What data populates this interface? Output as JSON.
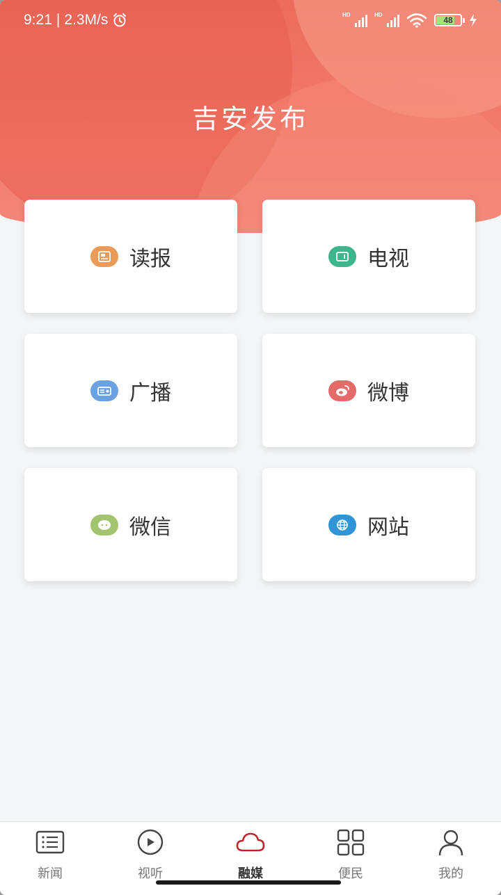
{
  "status_bar": {
    "time": "9:21",
    "separator": "|",
    "speed": "2.3M/s",
    "sim1_label": "HD",
    "sim2_label": "HD",
    "battery": "48"
  },
  "header": {
    "title": "吉安发布"
  },
  "cards": [
    {
      "label": "读报",
      "icon": "newspaper-icon",
      "color": "#ec9a57"
    },
    {
      "label": "电视",
      "icon": "tv-icon",
      "color": "#3fb58e"
    },
    {
      "label": "广播",
      "icon": "radio-icon",
      "color": "#6aa1e0"
    },
    {
      "label": "微博",
      "icon": "weibo-icon",
      "color": "#e56b6b"
    },
    {
      "label": "微信",
      "icon": "wechat-icon",
      "color": "#a3c46f"
    },
    {
      "label": "网站",
      "icon": "globe-icon",
      "color": "#2f95d6"
    }
  ],
  "tabbar": {
    "active_color": "#b8282e",
    "items": [
      {
        "label": "新闻",
        "icon": "list-icon"
      },
      {
        "label": "视听",
        "icon": "play-icon"
      },
      {
        "label": "融媒",
        "icon": "cloud-icon",
        "active": true
      },
      {
        "label": "便民",
        "icon": "grid-icon"
      },
      {
        "label": "我的",
        "icon": "user-icon"
      }
    ]
  }
}
